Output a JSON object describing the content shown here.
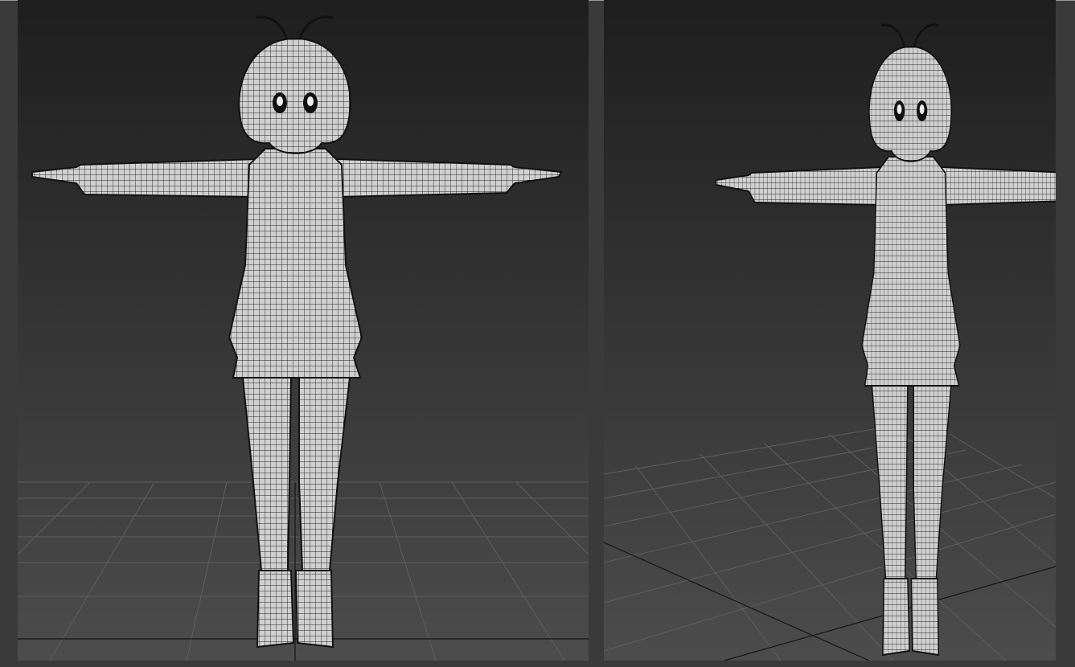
{
  "colors": {
    "frame": "#3a3a3a",
    "viewport_top": "#1e1e1e",
    "viewport_bottom": "#4a4a4a",
    "mesh_fill": "#d2d2d2",
    "mesh_wire": "#1a1a1a",
    "grid": "#5e5e5e"
  }
}
